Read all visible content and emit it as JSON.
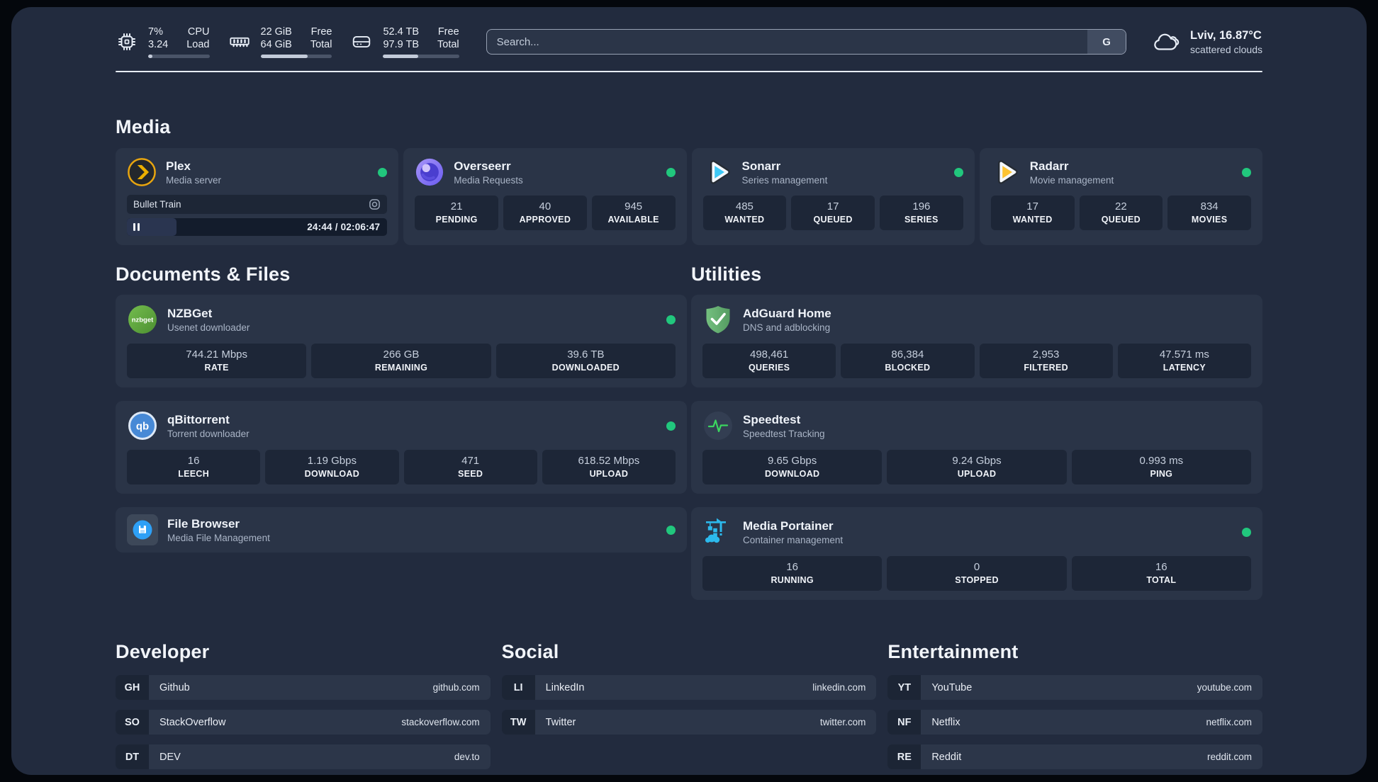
{
  "colors": {
    "page_background": "#222b3e",
    "card_background": "#2a3447",
    "stat_background": "#1d2637",
    "status_online": "#21c77d",
    "plex_orange": "#e8a50f",
    "overseerr_purple": "#8b7bf5",
    "sonarr_cyan": "#3ec8f5",
    "radarr_yellow": "#fdc331",
    "nzbget_green": "#5fa33e",
    "qbittorrent_blue": "#4789d6",
    "adguard_green": "#63b06f",
    "speedtest_green": "#3bd65f",
    "filebrowser_blue": "#2ea0f6",
    "portainer_blue": "#2cb9ec"
  },
  "top_bar": {
    "cpu": {
      "icon": "cpu-chip-icon",
      "values": [
        "7%",
        "3.24"
      ],
      "labels": [
        "CPU",
        "Load"
      ],
      "progress_pct": 7
    },
    "memory": {
      "icon": "ram-icon",
      "values": [
        "22 GiB",
        "64 GiB"
      ],
      "labels": [
        "Free",
        "Total"
      ],
      "progress_pct": 66
    },
    "disk": {
      "icon": "hard-drive-icon",
      "values": [
        "52.4 TB",
        "97.9 TB"
      ],
      "labels": [
        "Free",
        "Total"
      ],
      "progress_pct": 46
    },
    "search": {
      "placeholder": "Search...",
      "engine_button_label": "G"
    },
    "weather": {
      "icon": "cloud-icon",
      "headline": "Lviv, 16.87°C",
      "condition": "scattered clouds"
    }
  },
  "media": {
    "title": "Media",
    "cards": [
      {
        "name": "Plex",
        "subtitle": "Media server",
        "icon": "plex-icon",
        "status": "online",
        "player": {
          "title": "Bullet Train",
          "time": "24:44 / 02:06:47",
          "progress_pct": 19
        }
      },
      {
        "name": "Overseerr",
        "subtitle": "Media Requests",
        "icon": "overseerr-icon",
        "status": "online",
        "stats": [
          {
            "value": "21",
            "label": "PENDING"
          },
          {
            "value": "40",
            "label": "APPROVED"
          },
          {
            "value": "945",
            "label": "AVAILABLE"
          }
        ]
      },
      {
        "name": "Sonarr",
        "subtitle": "Series management",
        "icon": "sonarr-icon",
        "status": "online",
        "stats": [
          {
            "value": "485",
            "label": "WANTED"
          },
          {
            "value": "17",
            "label": "QUEUED"
          },
          {
            "value": "196",
            "label": "SERIES"
          }
        ]
      },
      {
        "name": "Radarr",
        "subtitle": "Movie management",
        "icon": "radarr-icon",
        "status": "online",
        "stats": [
          {
            "value": "17",
            "label": "WANTED"
          },
          {
            "value": "22",
            "label": "QUEUED"
          },
          {
            "value": "834",
            "label": "MOVIES"
          }
        ]
      }
    ]
  },
  "documents": {
    "title": "Documents & Files",
    "cards": [
      {
        "name": "NZBGet",
        "subtitle": "Usenet downloader",
        "icon": "nzbget-icon",
        "status": "online",
        "stats": [
          {
            "value": "744.21 Mbps",
            "label": "RATE"
          },
          {
            "value": "266 GB",
            "label": "REMAINING"
          },
          {
            "value": "39.6 TB",
            "label": "DOWNLOADED"
          }
        ]
      },
      {
        "name": "qBittorrent",
        "subtitle": "Torrent downloader",
        "icon": "qbittorrent-icon",
        "status": "online",
        "stats": [
          {
            "value": "16",
            "label": "LEECH"
          },
          {
            "value": "1.19 Gbps",
            "label": "DOWNLOAD"
          },
          {
            "value": "471",
            "label": "SEED"
          },
          {
            "value": "618.52 Mbps",
            "label": "UPLOAD"
          }
        ]
      },
      {
        "name": "File Browser",
        "subtitle": "Media File Management",
        "icon": "filebrowser-icon",
        "status": "online"
      }
    ]
  },
  "utilities": {
    "title": "Utilities",
    "cards": [
      {
        "name": "AdGuard Home",
        "subtitle": "DNS and adblocking",
        "icon": "adguard-icon",
        "stats": [
          {
            "value": "498,461",
            "label": "QUERIES"
          },
          {
            "value": "86,384",
            "label": "BLOCKED"
          },
          {
            "value": "2,953",
            "label": "FILTERED"
          },
          {
            "value": "47.571 ms",
            "label": "LATENCY"
          }
        ]
      },
      {
        "name": "Speedtest",
        "subtitle": "Speedtest Tracking",
        "icon": "speedtest-icon",
        "stats": [
          {
            "value": "9.65 Gbps",
            "label": "DOWNLOAD"
          },
          {
            "value": "9.24 Gbps",
            "label": "UPLOAD"
          },
          {
            "value": "0.993 ms",
            "label": "PING"
          }
        ]
      },
      {
        "name": "Media Portainer",
        "subtitle": "Container management",
        "icon": "portainer-icon",
        "status": "online",
        "stats": [
          {
            "value": "16",
            "label": "RUNNING"
          },
          {
            "value": "0",
            "label": "STOPPED"
          },
          {
            "value": "16",
            "label": "TOTAL"
          }
        ]
      }
    ]
  },
  "links": {
    "developer": {
      "title": "Developer",
      "items": [
        {
          "tag": "GH",
          "name": "Github",
          "url": "github.com"
        },
        {
          "tag": "SO",
          "name": "StackOverflow",
          "url": "stackoverflow.com"
        },
        {
          "tag": "DT",
          "name": "DEV",
          "url": "dev.to"
        }
      ]
    },
    "social": {
      "title": "Social",
      "items": [
        {
          "tag": "LI",
          "name": "LinkedIn",
          "url": "linkedin.com"
        },
        {
          "tag": "TW",
          "name": "Twitter",
          "url": "twitter.com"
        }
      ]
    },
    "entertainment": {
      "title": "Entertainment",
      "items": [
        {
          "tag": "YT",
          "name": "YouTube",
          "url": "youtube.com"
        },
        {
          "tag": "NF",
          "name": "Netflix",
          "url": "netflix.com"
        },
        {
          "tag": "RE",
          "name": "Reddit",
          "url": "reddit.com"
        }
      ]
    }
  }
}
